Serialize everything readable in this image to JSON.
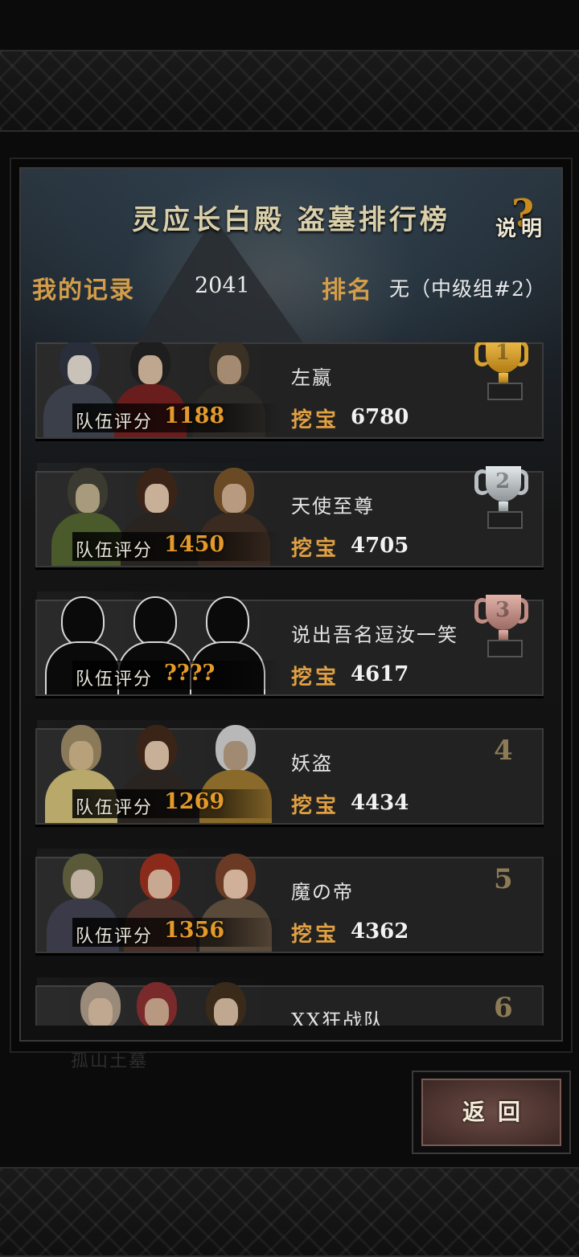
{
  "header": {
    "title": "灵应长白殿 盗墓排行榜",
    "help_label": "说明",
    "help_mark": "?"
  },
  "my_record": {
    "label": "我的记录",
    "value": "2041",
    "rank_label": "排名",
    "rank_value": "无（中级组#2）"
  },
  "entries": [
    {
      "rank": "1",
      "name": "左嬴",
      "score_label": "队伍评分",
      "score": "1188",
      "dig_label": "挖宝",
      "dig_value": "6780",
      "medal": "gold"
    },
    {
      "rank": "2",
      "name": "天使至尊",
      "score_label": "队伍评分",
      "score": "1450",
      "dig_label": "挖宝",
      "dig_value": "4705",
      "medal": "silver"
    },
    {
      "rank": "3",
      "name": "说出吾名逗汝一笑",
      "score_label": "队伍评分",
      "score": "????",
      "dig_label": "挖宝",
      "dig_value": "4617",
      "medal": "bronze"
    },
    {
      "rank": "4",
      "name": "妖盗",
      "score_label": "队伍评分",
      "score": "1269",
      "dig_label": "挖宝",
      "dig_value": "4434"
    },
    {
      "rank": "5",
      "name": "魔の帝",
      "score_label": "队伍评分",
      "score": "1356",
      "dig_label": "挖宝",
      "dig_value": "4362"
    },
    {
      "rank": "6",
      "name": "XX狂战队"
    }
  ],
  "background_text": "孤山土墓",
  "buttons": {
    "back_label": "返回"
  },
  "colors": {
    "accent": "#d39d4a",
    "score": "#e39a2a",
    "gold": "#f2c14e",
    "silver": "#e4e8ea",
    "bronze": "#e2b3aa"
  }
}
